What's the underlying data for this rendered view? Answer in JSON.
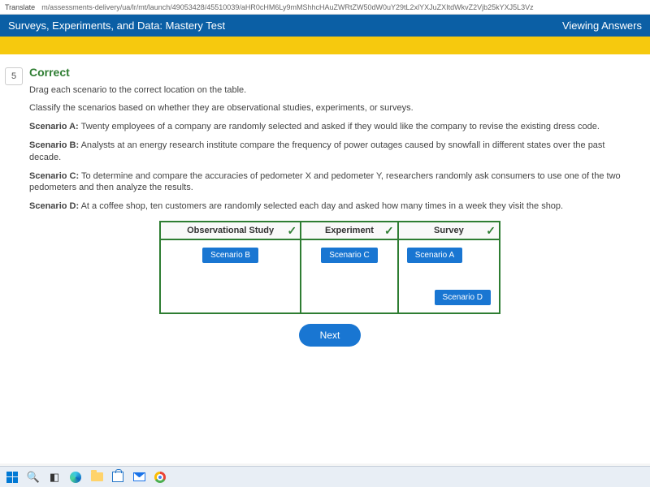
{
  "browser": {
    "tab_label": "Translate",
    "url": "m/assessments-delivery/ua/lr/mt/launch/49053428/45510039/aHR0cHM6Ly9mMShhcHAuZWRtZW50dW0uY29tL2xlYXJuZXItdWkvZ2Vjb25kYXJ5L3Vz"
  },
  "header": {
    "title": "Surveys, Experiments, and Data: Mastery Test",
    "status": "Viewing Answers"
  },
  "question": {
    "number": "5",
    "correct_label": "Correct",
    "instruction": "Drag each scenario to the correct location on the table.",
    "subtext": "Classify the scenarios based on whether they are observational studies, experiments, or surveys.",
    "scenarios": {
      "a": {
        "label": "Scenario A:",
        "text": "Twenty employees of a company are randomly selected and asked if they would like the company to revise the existing dress code."
      },
      "b": {
        "label": "Scenario B:",
        "text": "Analysts at an energy research institute compare the frequency of power outages caused by snowfall in different states over the past decade."
      },
      "c": {
        "label": "Scenario C:",
        "text": "To determine and compare the accuracies of pedometer X and pedometer Y, researchers randomly ask consumers to use one of the two pedometers and then analyze the results."
      },
      "d": {
        "label": "Scenario D:",
        "text": "At a coffee shop, ten customers are randomly selected each day and asked how many times in a week they visit the shop."
      }
    }
  },
  "table": {
    "columns": {
      "obs": "Observational Study",
      "exp": "Experiment",
      "sur": "Survey"
    },
    "placements": {
      "obs": [
        "Scenario B"
      ],
      "exp": [
        "Scenario C"
      ],
      "sur": [
        "Scenario A",
        "Scenario D"
      ]
    }
  },
  "buttons": {
    "next": "Next"
  }
}
